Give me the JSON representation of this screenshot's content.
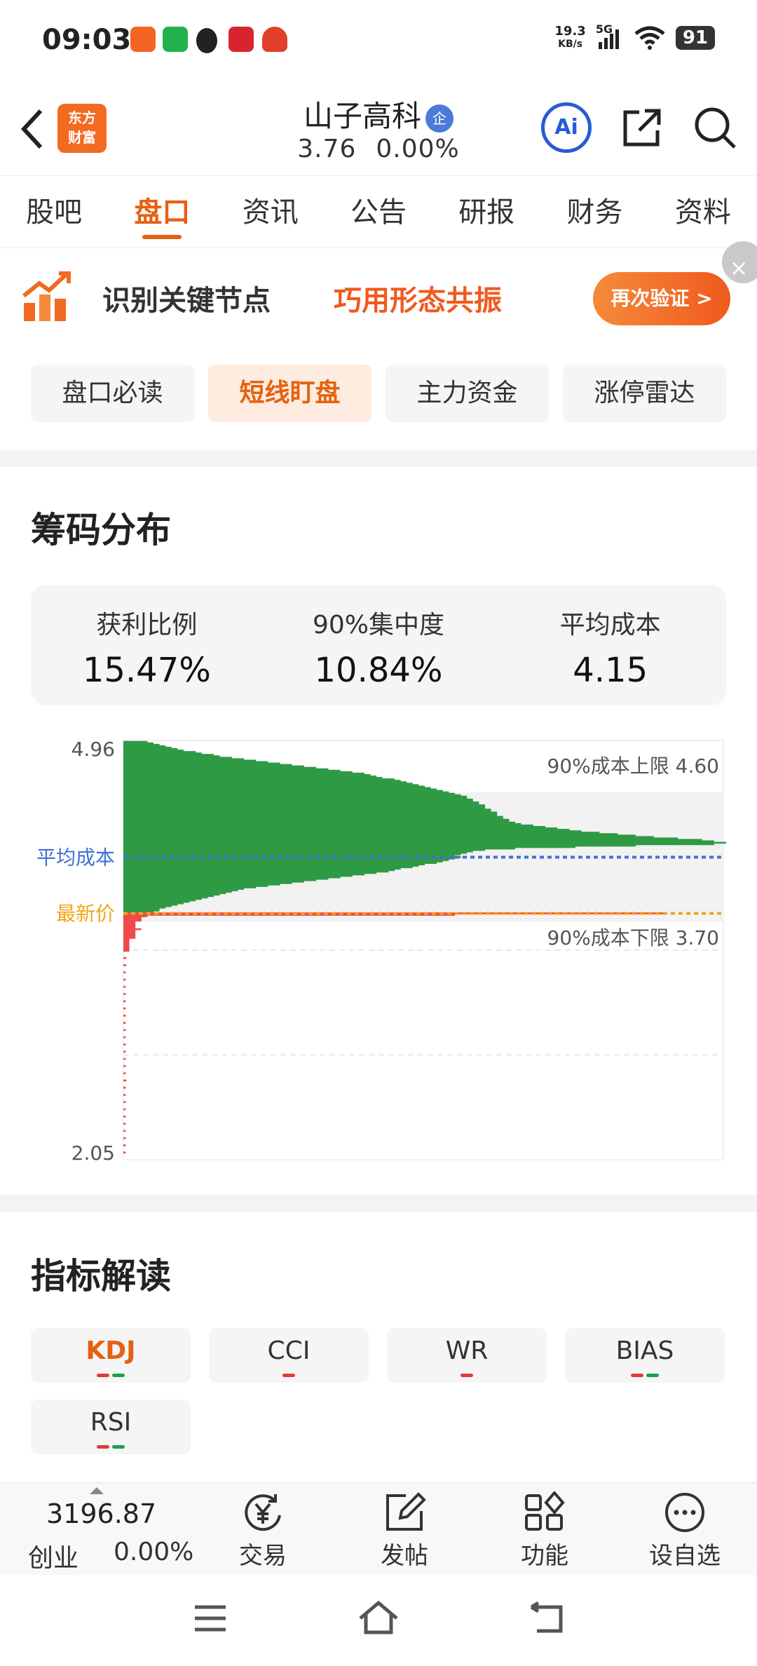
{
  "status": {
    "time": "09:03",
    "net_speed": "19.3",
    "net_unit": "KB/s",
    "signal": "5G",
    "battery": "91"
  },
  "header": {
    "logo_line1": "东方",
    "logo_line2": "财富",
    "stock_name": "山子高科",
    "badge": "企",
    "price": "3.76",
    "change": "0.00%",
    "ai_label": "Ai"
  },
  "tabs": [
    "股吧",
    "盘口",
    "资讯",
    "公告",
    "研报",
    "财务",
    "资料"
  ],
  "banner": {
    "text1": "识别关键节点",
    "text2": "巧用形态共振",
    "button": "再次验证 >",
    "close": "×"
  },
  "subtabs": [
    "盘口必读",
    "短线盯盘",
    "主力资金",
    "涨停雷达"
  ],
  "chips": {
    "title": "筹码分布",
    "stats": [
      {
        "label": "获利比例",
        "value": "15.47%"
      },
      {
        "label": "90%集中度",
        "value": "10.84%"
      },
      {
        "label": "平均成本",
        "value": "4.15"
      }
    ]
  },
  "chart_data": {
    "type": "bar",
    "orientation": "horizontal",
    "ylim": [
      2.05,
      4.96
    ],
    "ytick_labels": [
      "4.96",
      "2.05"
    ],
    "annotations": {
      "upper": "90%成本上限 4.60",
      "lower": "90%成本下限 3.70",
      "avg_label": "平均成本",
      "latest_label": "最新价"
    },
    "avg_cost": 4.15,
    "latest_price": 3.76,
    "band": [
      3.7,
      4.6
    ],
    "colors": {
      "profit": "#ef4b4b",
      "loss": "#2e9a44",
      "avg": "#3f6fd6",
      "latest": "#f2a51a"
    },
    "series": [
      {
        "color": "loss",
        "prices": [
          4.95,
          4.94,
          4.93,
          4.92,
          4.91,
          4.9,
          4.89,
          4.88,
          4.87,
          4.86,
          4.85,
          4.84,
          4.83,
          4.82,
          4.81,
          4.8,
          4.79,
          4.78,
          4.77,
          4.76,
          4.75,
          4.74,
          4.73,
          4.72,
          4.71,
          4.7,
          4.69,
          4.68,
          4.67,
          4.66,
          4.65,
          4.64,
          4.63,
          4.62,
          4.61,
          4.6,
          4.59,
          4.58,
          4.57,
          4.56,
          4.55,
          4.54,
          4.53,
          4.52,
          4.51,
          4.5,
          4.49,
          4.48,
          4.47,
          4.46,
          4.45,
          4.44,
          4.43,
          4.42,
          4.41,
          4.4,
          4.39,
          4.38,
          4.37,
          4.36,
          4.35,
          4.34,
          4.33,
          4.32,
          4.31,
          4.3,
          4.29,
          4.28,
          4.27,
          4.26,
          4.25,
          4.24,
          4.23,
          4.22,
          4.21,
          4.2,
          4.19,
          4.18,
          4.17,
          4.16,
          4.15,
          4.14,
          4.13,
          4.12,
          4.11,
          4.1,
          4.09,
          4.08,
          4.07,
          4.06,
          4.05,
          4.04,
          4.03,
          4.02,
          4.01,
          4.0,
          3.99,
          3.98,
          3.97,
          3.96,
          3.95,
          3.94,
          3.93,
          3.92,
          3.91,
          3.9,
          3.89,
          3.88,
          3.87,
          3.86,
          3.85,
          3.84,
          3.83,
          3.82,
          3.81,
          3.8,
          3.79,
          3.78,
          3.77
        ],
        "values": [
          0.04,
          0.05,
          0.06,
          0.07,
          0.08,
          0.09,
          0.1,
          0.12,
          0.13,
          0.15,
          0.16,
          0.18,
          0.2,
          0.22,
          0.24,
          0.26,
          0.28,
          0.3,
          0.32,
          0.34,
          0.36,
          0.38,
          0.4,
          0.41,
          0.42,
          0.43,
          0.45,
          0.46,
          0.47,
          0.48,
          0.49,
          0.5,
          0.51,
          0.52,
          0.53,
          0.54,
          0.55,
          0.56,
          0.57,
          0.57,
          0.58,
          0.58,
          0.59,
          0.59,
          0.6,
          0.6,
          0.6,
          0.61,
          0.61,
          0.62,
          0.62,
          0.62,
          0.63,
          0.63,
          0.64,
          0.64,
          0.65,
          0.66,
          0.68,
          0.7,
          0.72,
          0.74,
          0.76,
          0.79,
          0.82,
          0.85,
          0.88,
          0.92,
          0.96,
          0.98,
          1.0,
          0.98,
          0.85,
          0.75,
          0.65,
          0.6,
          0.58,
          0.57,
          0.56,
          0.55,
          0.56,
          0.55,
          0.54,
          0.53,
          0.52,
          0.5,
          0.49,
          0.48,
          0.46,
          0.45,
          0.44,
          0.42,
          0.4,
          0.38,
          0.36,
          0.34,
          0.32,
          0.3,
          0.28,
          0.26,
          0.24,
          0.22,
          0.2,
          0.19,
          0.18,
          0.17,
          0.16,
          0.15,
          0.14,
          0.13,
          0.12,
          0.11,
          0.1,
          0.09,
          0.08,
          0.07,
          0.06,
          0.06,
          0.05
        ]
      },
      {
        "color": "profit",
        "prices": [
          3.76,
          3.75,
          3.74,
          3.73,
          3.72,
          3.71,
          3.7,
          3.69,
          3.68,
          3.67,
          3.66,
          3.65,
          3.64,
          3.63,
          3.62,
          3.61,
          3.6,
          3.59,
          3.58,
          3.57,
          3.56,
          3.55,
          3.54,
          3.53,
          3.52,
          3.51,
          3.5,
          3.45,
          3.4,
          3.35,
          3.3,
          3.25,
          3.2,
          3.15,
          3.1,
          3.05,
          3.0,
          2.95,
          2.9,
          2.85,
          2.8,
          2.75,
          2.7,
          2.65,
          2.6,
          2.55,
          2.5,
          2.45,
          2.4,
          2.35,
          2.3,
          2.25,
          2.2,
          2.15,
          2.1
        ],
        "values": [
          0.9,
          0.55,
          0.04,
          0.03,
          0.03,
          0.03,
          0.02,
          0.02,
          0.02,
          0.02,
          0.02,
          0.03,
          0.02,
          0.02,
          0.02,
          0.02,
          0.02,
          0.02,
          0.01,
          0.01,
          0.01,
          0.01,
          0.01,
          0.01,
          0.01,
          0.01,
          0.01,
          0.005,
          0.005,
          0.004,
          0.004,
          0.004,
          0.004,
          0.004,
          0.004,
          0.004,
          0.004,
          0.004,
          0.004,
          0.004,
          0.004,
          0.004,
          0.004,
          0.004,
          0.005,
          0.004,
          0.004,
          0.004,
          0.004,
          0.004,
          0.004,
          0.004,
          0.004,
          0.004,
          0.004
        ]
      }
    ]
  },
  "indicators": {
    "title": "指标解读",
    "items": [
      {
        "label": "KDJ",
        "dots": [
          "red",
          "green"
        ]
      },
      {
        "label": "CCI",
        "dots": [
          "red"
        ]
      },
      {
        "label": "WR",
        "dots": [
          "red"
        ]
      },
      {
        "label": "BIAS",
        "dots": [
          "red",
          "green"
        ]
      },
      {
        "label": "RSI",
        "dots": [
          "red",
          "green"
        ]
      }
    ]
  },
  "bottombar": {
    "index_value": "3196.87",
    "index_name": "创业",
    "index_change": "0.00%",
    "trade": "交易",
    "post": "发帖",
    "functions": "功能",
    "watchlist": "设自选"
  }
}
